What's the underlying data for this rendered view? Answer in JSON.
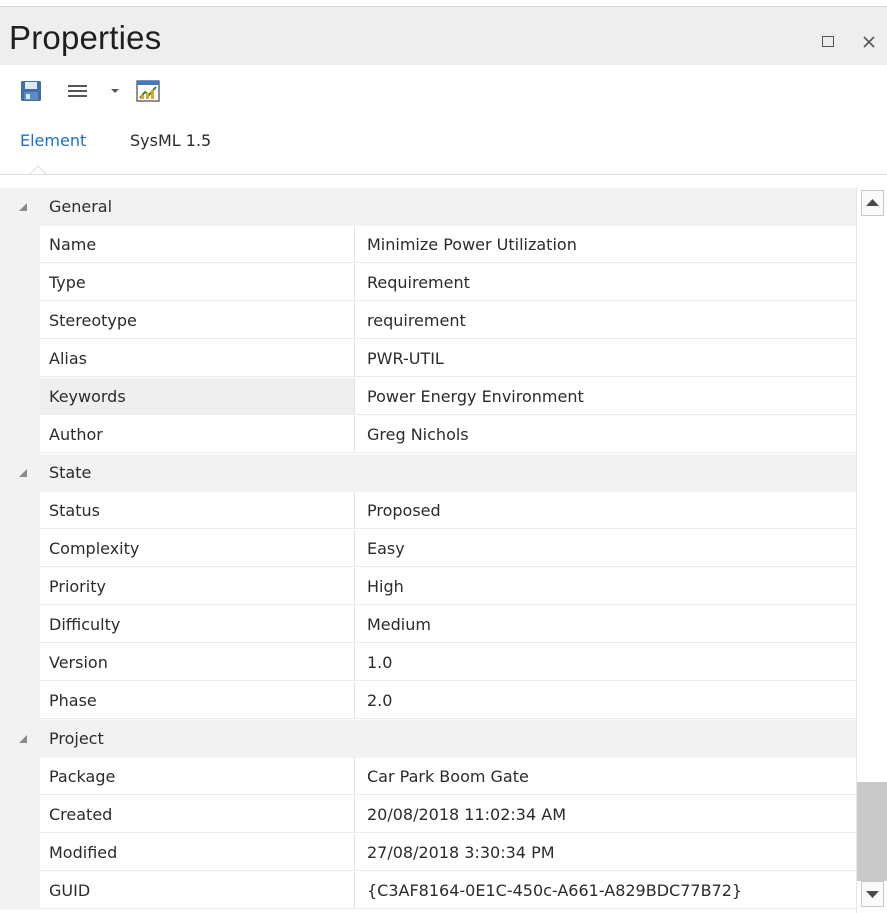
{
  "window": {
    "title": "Properties"
  },
  "tabs": [
    {
      "label": "Element",
      "active": true
    },
    {
      "label": "SysML 1.5",
      "active": false
    }
  ],
  "toolbar": {
    "icons": [
      "save-icon",
      "menu-lines-icon",
      "dropdown-arrow-icon",
      "chart-properties-icon"
    ]
  },
  "groups": [
    {
      "label": "General",
      "rows": [
        {
          "key": "Name",
          "value": "Minimize Power Utilization"
        },
        {
          "key": "Type",
          "value": "Requirement"
        },
        {
          "key": "Stereotype",
          "value": "requirement"
        },
        {
          "key": "Alias",
          "value": "PWR-UTIL"
        },
        {
          "key": "Keywords",
          "value": "Power Energy Environment"
        },
        {
          "key": "Author",
          "value": "Greg Nichols"
        }
      ]
    },
    {
      "label": "State",
      "rows": [
        {
          "key": "Status",
          "value": "Proposed"
        },
        {
          "key": "Complexity",
          "value": "Easy"
        },
        {
          "key": "Priority",
          "value": "High"
        },
        {
          "key": "Difficulty",
          "value": "Medium"
        },
        {
          "key": "Version",
          "value": "1.0"
        },
        {
          "key": "Phase",
          "value": "2.0"
        }
      ]
    },
    {
      "label": "Project",
      "rows": [
        {
          "key": "Package",
          "value": "Car Park Boom Gate"
        },
        {
          "key": "Created",
          "value": "20/08/2018 11:02:34 AM"
        },
        {
          "key": "Modified",
          "value": "27/08/2018 3:30:34 PM"
        },
        {
          "key": "GUID",
          "value": "{C3AF8164-0E1C-450c-A661-A829BDC77B72}"
        }
      ]
    }
  ],
  "colors": {
    "accent": "#1c6fc6",
    "header_bg": "#eeeeee",
    "group_bg": "#f2f2f2",
    "scrollbar_track": "#c9c9c9"
  }
}
